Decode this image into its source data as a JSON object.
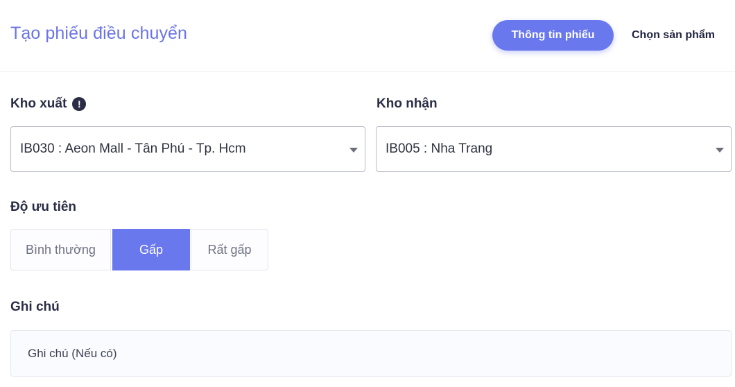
{
  "header": {
    "title": "Tạo phiếu điều chuyển",
    "tabs": [
      {
        "label": "Thông tin phiếu",
        "active": true
      },
      {
        "label": "Chọn sản phẩm",
        "active": false
      }
    ]
  },
  "form": {
    "source_warehouse": {
      "label": "Kho xuất",
      "info_icon": "exclamation-circle-icon",
      "value": "IB030 : Aeon Mall - Tân Phú - Tp. Hcm"
    },
    "target_warehouse": {
      "label": "Kho nhận",
      "value": "IB005 : Nha Trang"
    },
    "priority": {
      "label": "Độ ưu tiên",
      "options": [
        "Bình thường",
        "Gấp",
        "Rất gấp"
      ],
      "selected": "Gấp"
    },
    "note": {
      "label": "Ghi chú",
      "placeholder": "Ghi chú (Nếu có)"
    }
  },
  "colors": {
    "accent": "#6a78ee",
    "title": "#6a74e8",
    "text": "#2a2d45"
  }
}
